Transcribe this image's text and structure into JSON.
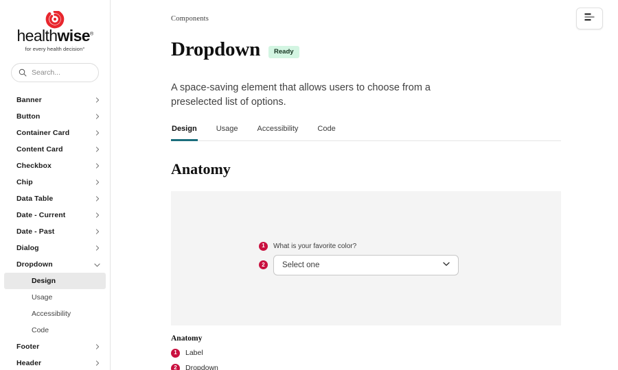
{
  "brand": {
    "wordmark_light": "health",
    "wordmark_bold": "wise",
    "registered": "®",
    "tagline": "for every health decision°",
    "logo_color": "#e8262d"
  },
  "search": {
    "placeholder": "Search...",
    "value": "",
    "icon": "search-icon"
  },
  "sidebar": {
    "items": [
      {
        "label": "Banner",
        "icon": "chevron-right-icon",
        "expanded": false
      },
      {
        "label": "Button",
        "icon": "chevron-right-icon",
        "expanded": false
      },
      {
        "label": "Container Card",
        "icon": "chevron-right-icon",
        "expanded": false
      },
      {
        "label": "Content Card",
        "icon": "chevron-right-icon",
        "expanded": false
      },
      {
        "label": "Checkbox",
        "icon": "chevron-right-icon",
        "expanded": false
      },
      {
        "label": "Chip",
        "icon": "chevron-right-icon",
        "expanded": false
      },
      {
        "label": "Data Table",
        "icon": "chevron-right-icon",
        "expanded": false
      },
      {
        "label": "Date - Current",
        "icon": "chevron-right-icon",
        "expanded": false
      },
      {
        "label": "Date - Past",
        "icon": "chevron-right-icon",
        "expanded": false
      },
      {
        "label": "Dialog",
        "icon": "chevron-right-icon",
        "expanded": false
      },
      {
        "label": "Dropdown",
        "icon": "chevron-down-icon",
        "expanded": true
      },
      {
        "label": "Footer",
        "icon": "chevron-right-icon",
        "expanded": false
      },
      {
        "label": "Header",
        "icon": "chevron-right-icon",
        "expanded": false
      }
    ],
    "dropdown_children": [
      {
        "label": "Design",
        "active": true
      },
      {
        "label": "Usage",
        "active": false
      },
      {
        "label": "Accessibility",
        "active": false
      },
      {
        "label": "Code",
        "active": false
      }
    ],
    "active_item": "Design",
    "highlight_color": "#e9e9e9"
  },
  "header": {
    "breadcrumb": "Components",
    "title": "Dropdown",
    "status_badge": "Ready",
    "badge_bg": "#d3f5e2",
    "description": "A space-saving element that allows users to choose from a preselected list of options.",
    "toc_button_icon": "list-lines-icon"
  },
  "tabs": [
    {
      "label": "Design",
      "active": true
    },
    {
      "label": "Usage",
      "active": false
    },
    {
      "label": "Accessibility",
      "active": false
    },
    {
      "label": "Code",
      "active": false
    }
  ],
  "tab_accent_color": "#1b6d7c",
  "anatomy": {
    "section_title": "Anatomy",
    "panel_bg": "#f4f4f4",
    "marker_color": "#c9103f",
    "demo": {
      "marker_1": "1",
      "field_label": "What is your favorite color?",
      "marker_2": "2",
      "select_value": "Select one",
      "select_icon": "chevron-down-icon"
    },
    "legend_title": "Anatomy",
    "legend_items": [
      {
        "number": "1",
        "label": "Label"
      },
      {
        "number": "2",
        "label": "Dropdown"
      }
    ]
  }
}
